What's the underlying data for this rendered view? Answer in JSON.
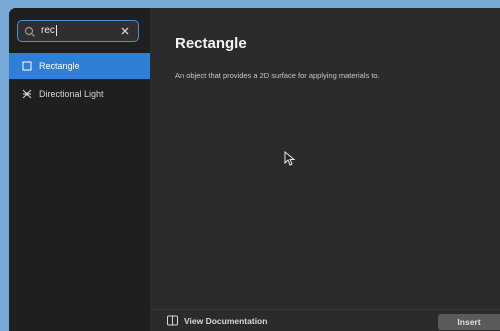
{
  "search": {
    "value": "rec",
    "clear_icon": "close-icon",
    "icon": "search-icon"
  },
  "sidebar": {
    "items": [
      {
        "label": "Rectangle",
        "icon": "rectangle-icon",
        "selected": true
      },
      {
        "label": "Directional Light",
        "icon": "directional-light-icon",
        "selected": false
      }
    ]
  },
  "detail": {
    "title": "Rectangle",
    "description": "An object that provides a 2D surface for applying materials to."
  },
  "footer": {
    "doc_label": "View Documentation",
    "doc_icon": "documentation-icon",
    "insert_label": "Insert"
  },
  "colors": {
    "accent": "#2f7fd7",
    "background": "#2b2b2b",
    "sidebar": "#1f1f1f"
  }
}
